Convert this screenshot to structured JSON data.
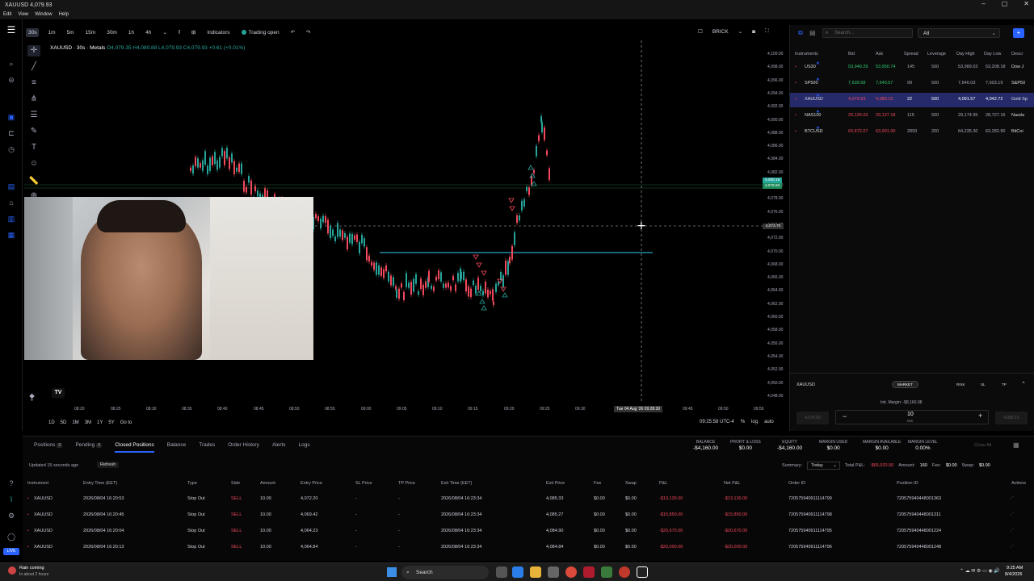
{
  "window": {
    "title": "XAUUSD 4,079.93",
    "menu": [
      "Edit",
      "View",
      "Window",
      "Help"
    ]
  },
  "toolbar": {
    "timeframes": [
      "30s",
      "1m",
      "5m",
      "15m",
      "30m",
      "1h",
      "4h"
    ],
    "active_timeframe": "30s",
    "indicators_label": "Indicators",
    "trading_status": "Trading open",
    "chart_type_label": "BRICK"
  },
  "legend": {
    "symbol": "XAUUSD · 30s · Metals",
    "ohlc": "O4,079.35  H4,080.88  L4,079.93  C4,079.93  +0.61 (+0.01%)"
  },
  "price_axis": [
    "4,100.00",
    "4,098.00",
    "4,096.00",
    "4,094.00",
    "4,092.00",
    "4,090.00",
    "4,088.00",
    "4,086.00",
    "4,084.00",
    "4,082.00",
    "4,080.00",
    "4,078.00",
    "4,076.00",
    "4,074.00",
    "4,072.00",
    "4,070.00",
    "4,068.00",
    "4,066.00",
    "4,064.00",
    "4,062.00",
    "4,060.00",
    "4,058.00",
    "4,056.00",
    "4,054.00",
    "4,052.00",
    "4,050.00",
    "4,048.00"
  ],
  "price_tags": {
    "bid": "4,080.15",
    "ask": "4,079.93",
    "cursor": "4,073.70"
  },
  "time_axis": [
    "08:20",
    "08:25",
    "08:30",
    "08:35",
    "08:40",
    "08:45",
    "08:50",
    "08:55",
    "09:00",
    "09:05",
    "09:10",
    "09:15",
    "09:20",
    "09:25",
    "09:30",
    "09:45",
    "09:50",
    "09:55"
  ],
  "cursor_time": "Tue 04 Aug '26  09:28:30",
  "bottom_bar": {
    "ranges": [
      "1D",
      "5D",
      "1M",
      "3M",
      "1Y",
      "5Y"
    ],
    "goto": "Go to",
    "clock": "09:25:58 UTC-4",
    "pct": "%",
    "log": "log",
    "auto": "auto"
  },
  "right_panel": {
    "search_placeholder": "Search...",
    "filter": "All",
    "headers": [
      "Instruments",
      "Bid",
      "Ask",
      "Spread",
      "Leverage",
      "Day High",
      "Day Low",
      "Descr"
    ],
    "rows": [
      {
        "sym": "US30",
        "bid": "53,949.29",
        "ask": "53,950.74",
        "spread": "145",
        "lev": "500",
        "high": "53,989.03",
        "low": "53,208.18",
        "desc": "Dow J"
      },
      {
        "sym": "SP500",
        "bid": "7,639.58",
        "ask": "7,640.57",
        "spread": "99",
        "lev": "500",
        "high": "7,646.03",
        "low": "7,603.19",
        "desc": "S&P50"
      },
      {
        "sym": "XAUUSD",
        "bid": "4,079.93",
        "ask": "4,080.15",
        "spread": "22",
        "lev": "500",
        "high": "4,091.57",
        "low": "4,042.72",
        "desc": "Gold Sp"
      },
      {
        "sym": "NAS100",
        "bid": "29,126.03",
        "ask": "29,127.18",
        "spread": "115",
        "lev": "500",
        "high": "29,174.95",
        "low": "28,727.16",
        "desc": "Nasda"
      },
      {
        "sym": "BTCUSD",
        "bid": "63,872.07",
        "ask": "63,901.00",
        "spread": "2893",
        "lev": "200",
        "high": "64,235.30",
        "low": "63,282.90",
        "desc": "BitCoi"
      }
    ],
    "order": {
      "symbol": "XAUUSD",
      "market": "MARKET",
      "init_margin": "Init. Margin: -$8,160.08",
      "lots": "10",
      "lots_label": "lots",
      "sell_price": "4,079.93",
      "buy_price": "4,080.15",
      "btns": [
        "RISK",
        "SL",
        "TP"
      ]
    }
  },
  "bottom_panel": {
    "tabs": [
      {
        "label": "Positions",
        "count": "0"
      },
      {
        "label": "Pending",
        "count": "0"
      },
      {
        "label": "Closed Positions",
        "count": ""
      },
      {
        "label": "Balance",
        "count": ""
      },
      {
        "label": "Trades",
        "count": ""
      },
      {
        "label": "Order History",
        "count": ""
      },
      {
        "label": "Alerts",
        "count": ""
      },
      {
        "label": "Logs",
        "count": ""
      }
    ],
    "stats": [
      {
        "l": "BALANCE",
        "v": "-$4,160.00"
      },
      {
        "l": "PROFIT & LOSS",
        "v": "$0.00"
      },
      {
        "l": "EQUITY",
        "v": "-$4,160.00"
      },
      {
        "l": "MARGIN USED",
        "v": "$0.00"
      },
      {
        "l": "MARGIN AVAILABLE",
        "v": "$0.00"
      },
      {
        "l": "MARGIN LEVEL",
        "v": "0.00%"
      }
    ],
    "close_all": "Close All",
    "updated": "Updated 15 seconds ago",
    "refresh": "Refresh",
    "summary_label": "Summary:",
    "summary_value": "Today",
    "total_pl_label": "Total P&L:",
    "total_pl": "-$65,920.00",
    "amount_label": "Amount:",
    "amount": "160",
    "fee_label": "Fee:",
    "fee": "$0.00",
    "swap_label": "Swap:",
    "swap": "$0.00",
    "headers": [
      "Instrument",
      "Entry Time (EET)",
      "Type",
      "Side",
      "Amount",
      "Entry Price",
      "SL Price",
      "TP Price",
      "Exit Time (EET)",
      "Exit Price",
      "Fee",
      "Swap",
      "P&L",
      "Net P&L",
      "Order ID",
      "Position ID",
      "Actions"
    ],
    "rows": [
      [
        "XAUUSD",
        "2026/08/04 16:20:53",
        "Stop Out",
        "SELL",
        "10.00",
        "4,072.20",
        "-",
        "-",
        "2026/08/04 16:23:34",
        "4,085.33",
        "$0.00",
        "$0.00",
        "-$13,130.00",
        "-$13,130.00",
        "720575940911114799",
        "720575940448001363"
      ],
      [
        "XAUUSD",
        "2026/08/04 16:20:45",
        "Stop Out",
        "SELL",
        "10.00",
        "4,069.42",
        "-",
        "-",
        "2026/08/04 16:23:34",
        "4,085.27",
        "$0.00",
        "$0.00",
        "-$15,850.00",
        "-$15,850.00",
        "720575940911114798",
        "720575940448001311"
      ],
      [
        "XAUUSD",
        "2026/08/04 16:20:04",
        "Stop Out",
        "SELL",
        "10.00",
        "4,064.23",
        "-",
        "-",
        "2026/08/04 16:23:34",
        "4,084.90",
        "$0.00",
        "$0.00",
        "-$20,670.00",
        "-$20,670.00",
        "720575940911114795",
        "720575940448001224"
      ],
      [
        "XAUUSD",
        "2026/08/04 16:20:13",
        "Stop Out",
        "SELL",
        "10.00",
        "4,064.84",
        "-",
        "-",
        "2026/08/04 16:23:34",
        "4,084.84",
        "$0.00",
        "$0.00",
        "-$20,000.00",
        "-$20,000.00",
        "720575940911114796",
        "720575940448001248"
      ]
    ]
  },
  "taskbar": {
    "weather_title": "Rain coming",
    "weather_sub": "In about 2 hours",
    "search": "Search",
    "time": "9:25 AM",
    "date": "8/4/2026",
    "live": "LIVE"
  },
  "colors": {
    "up": "#26a69a",
    "down": "#f2495c",
    "accent": "#2962ff"
  }
}
